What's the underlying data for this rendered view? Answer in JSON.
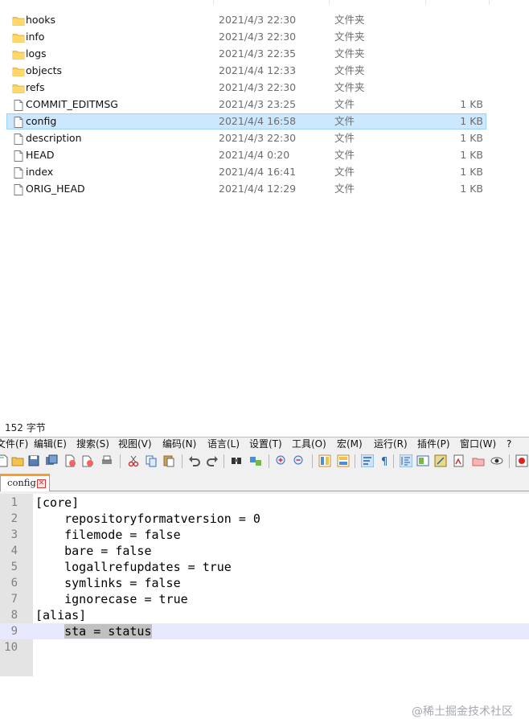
{
  "explorer": {
    "files": [
      {
        "name": "hooks",
        "date": "2021/4/3 22:30",
        "type": "文件夹",
        "size": "",
        "kind": "folder",
        "selected": false
      },
      {
        "name": "info",
        "date": "2021/4/3 22:30",
        "type": "文件夹",
        "size": "",
        "kind": "folder",
        "selected": false
      },
      {
        "name": "logs",
        "date": "2021/4/3 22:35",
        "type": "文件夹",
        "size": "",
        "kind": "folder",
        "selected": false
      },
      {
        "name": "objects",
        "date": "2021/4/4 12:33",
        "type": "文件夹",
        "size": "",
        "kind": "folder",
        "selected": false
      },
      {
        "name": "refs",
        "date": "2021/4/3 22:30",
        "type": "文件夹",
        "size": "",
        "kind": "folder",
        "selected": false
      },
      {
        "name": "COMMIT_EDITMSG",
        "date": "2021/4/3 23:25",
        "type": "文件",
        "size": "1 KB",
        "kind": "file",
        "selected": false
      },
      {
        "name": "config",
        "date": "2021/4/4 16:58",
        "type": "文件",
        "size": "1 KB",
        "kind": "file",
        "selected": true
      },
      {
        "name": "description",
        "date": "2021/4/3 22:30",
        "type": "文件",
        "size": "1 KB",
        "kind": "file",
        "selected": false
      },
      {
        "name": "HEAD",
        "date": "2021/4/4 0:20",
        "type": "文件",
        "size": "1 KB",
        "kind": "file",
        "selected": false
      },
      {
        "name": "index",
        "date": "2021/4/4 16:41",
        "type": "文件",
        "size": "1 KB",
        "kind": "file",
        "selected": false
      },
      {
        "name": "ORIG_HEAD",
        "date": "2021/4/4 12:29",
        "type": "文件",
        "size": "1 KB",
        "kind": "file",
        "selected": false
      }
    ],
    "status": "152 字节"
  },
  "notepad": {
    "menu": [
      "文件(F)",
      "编辑(E)",
      "搜索(S)",
      "视图(V)",
      "编码(N)",
      "语言(L)",
      "设置(T)",
      "工具(O)",
      "宏(M)",
      "运行(R)",
      "插件(P)",
      "窗口(W)",
      "?"
    ],
    "toolbar_icons": [
      "new-file-icon",
      "open-file-icon",
      "save-icon",
      "save-all-icon",
      "close-icon",
      "close-all-icon",
      "print-icon",
      "cut-icon",
      "copy-icon",
      "paste-icon",
      "undo-icon",
      "redo-icon",
      "find-icon",
      "replace-icon",
      "zoom-in-icon",
      "zoom-out-icon",
      "sync-vertical-icon",
      "sync-horizontal-icon",
      "word-wrap-icon",
      "show-all-chars-icon",
      "indent-guide-icon",
      "document-map-icon",
      "function-list-icon",
      "folder-workspace-icon",
      "monitoring-icon",
      "preview-icon",
      "record-macro-icon"
    ],
    "tab": {
      "label": "config",
      "close_glyph": "✕"
    },
    "lines": [
      {
        "num": "1",
        "text": "[core]",
        "current": false
      },
      {
        "num": "2",
        "text": "    repositoryformatversion = 0",
        "current": false
      },
      {
        "num": "3",
        "text": "    filemode = false",
        "current": false
      },
      {
        "num": "4",
        "text": "    bare = false",
        "current": false
      },
      {
        "num": "5",
        "text": "    logallrefupdates = true",
        "current": false
      },
      {
        "num": "6",
        "text": "    symlinks = false",
        "current": false
      },
      {
        "num": "7",
        "text": "    ignorecase = true",
        "current": false
      },
      {
        "num": "8",
        "text": "[alias]",
        "current": false
      },
      {
        "num": "9",
        "text": "    sta = status",
        "current": true
      },
      {
        "num": "10",
        "text": "",
        "current": false
      }
    ],
    "watermark": "@稀土掘金技术社区"
  },
  "colors": {
    "selection_bg": "#cce8ff",
    "selection_border": "#99d1ff",
    "folder": "#f8cf5a",
    "tab_accent": "#fa9d27",
    "current_line": "#e8e8ff",
    "gutter": "#e4e4e4"
  }
}
